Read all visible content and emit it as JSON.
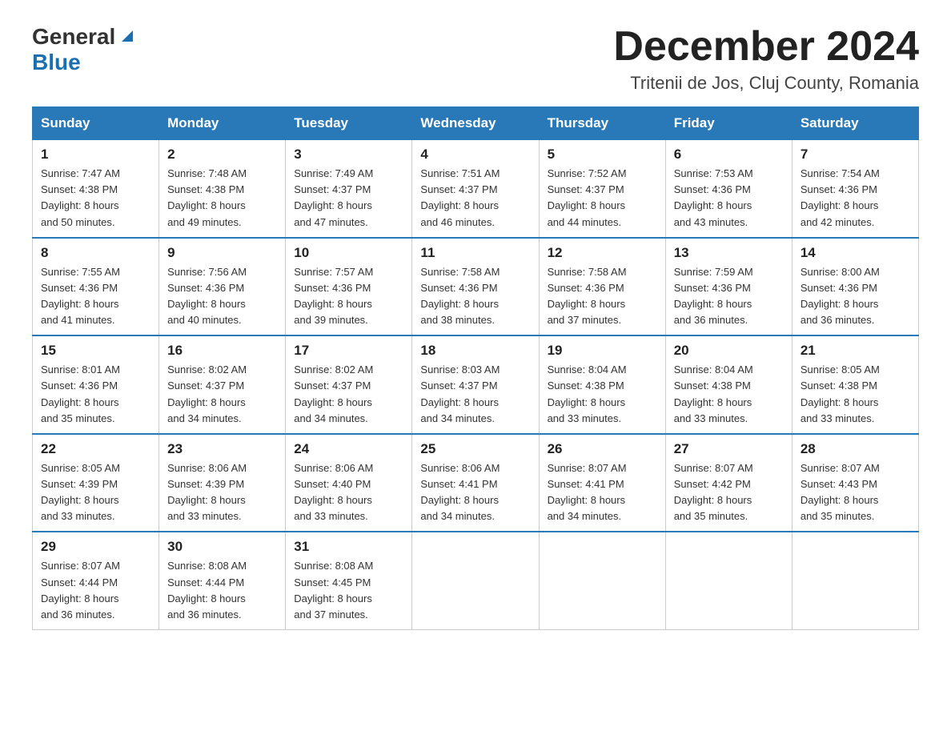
{
  "logo": {
    "general": "General",
    "blue": "Blue"
  },
  "title": {
    "month": "December 2024",
    "location": "Tritenii de Jos, Cluj County, Romania"
  },
  "weekdays": [
    "Sunday",
    "Monday",
    "Tuesday",
    "Wednesday",
    "Thursday",
    "Friday",
    "Saturday"
  ],
  "weeks": [
    [
      {
        "day": "1",
        "sunrise": "7:47 AM",
        "sunset": "4:38 PM",
        "daylight": "8 hours and 50 minutes."
      },
      {
        "day": "2",
        "sunrise": "7:48 AM",
        "sunset": "4:38 PM",
        "daylight": "8 hours and 49 minutes."
      },
      {
        "day": "3",
        "sunrise": "7:49 AM",
        "sunset": "4:37 PM",
        "daylight": "8 hours and 47 minutes."
      },
      {
        "day": "4",
        "sunrise": "7:51 AM",
        "sunset": "4:37 PM",
        "daylight": "8 hours and 46 minutes."
      },
      {
        "day": "5",
        "sunrise": "7:52 AM",
        "sunset": "4:37 PM",
        "daylight": "8 hours and 44 minutes."
      },
      {
        "day": "6",
        "sunrise": "7:53 AM",
        "sunset": "4:36 PM",
        "daylight": "8 hours and 43 minutes."
      },
      {
        "day": "7",
        "sunrise": "7:54 AM",
        "sunset": "4:36 PM",
        "daylight": "8 hours and 42 minutes."
      }
    ],
    [
      {
        "day": "8",
        "sunrise": "7:55 AM",
        "sunset": "4:36 PM",
        "daylight": "8 hours and 41 minutes."
      },
      {
        "day": "9",
        "sunrise": "7:56 AM",
        "sunset": "4:36 PM",
        "daylight": "8 hours and 40 minutes."
      },
      {
        "day": "10",
        "sunrise": "7:57 AM",
        "sunset": "4:36 PM",
        "daylight": "8 hours and 39 minutes."
      },
      {
        "day": "11",
        "sunrise": "7:58 AM",
        "sunset": "4:36 PM",
        "daylight": "8 hours and 38 minutes."
      },
      {
        "day": "12",
        "sunrise": "7:58 AM",
        "sunset": "4:36 PM",
        "daylight": "8 hours and 37 minutes."
      },
      {
        "day": "13",
        "sunrise": "7:59 AM",
        "sunset": "4:36 PM",
        "daylight": "8 hours and 36 minutes."
      },
      {
        "day": "14",
        "sunrise": "8:00 AM",
        "sunset": "4:36 PM",
        "daylight": "8 hours and 36 minutes."
      }
    ],
    [
      {
        "day": "15",
        "sunrise": "8:01 AM",
        "sunset": "4:36 PM",
        "daylight": "8 hours and 35 minutes."
      },
      {
        "day": "16",
        "sunrise": "8:02 AM",
        "sunset": "4:37 PM",
        "daylight": "8 hours and 34 minutes."
      },
      {
        "day": "17",
        "sunrise": "8:02 AM",
        "sunset": "4:37 PM",
        "daylight": "8 hours and 34 minutes."
      },
      {
        "day": "18",
        "sunrise": "8:03 AM",
        "sunset": "4:37 PM",
        "daylight": "8 hours and 34 minutes."
      },
      {
        "day": "19",
        "sunrise": "8:04 AM",
        "sunset": "4:38 PM",
        "daylight": "8 hours and 33 minutes."
      },
      {
        "day": "20",
        "sunrise": "8:04 AM",
        "sunset": "4:38 PM",
        "daylight": "8 hours and 33 minutes."
      },
      {
        "day": "21",
        "sunrise": "8:05 AM",
        "sunset": "4:38 PM",
        "daylight": "8 hours and 33 minutes."
      }
    ],
    [
      {
        "day": "22",
        "sunrise": "8:05 AM",
        "sunset": "4:39 PM",
        "daylight": "8 hours and 33 minutes."
      },
      {
        "day": "23",
        "sunrise": "8:06 AM",
        "sunset": "4:39 PM",
        "daylight": "8 hours and 33 minutes."
      },
      {
        "day": "24",
        "sunrise": "8:06 AM",
        "sunset": "4:40 PM",
        "daylight": "8 hours and 33 minutes."
      },
      {
        "day": "25",
        "sunrise": "8:06 AM",
        "sunset": "4:41 PM",
        "daylight": "8 hours and 34 minutes."
      },
      {
        "day": "26",
        "sunrise": "8:07 AM",
        "sunset": "4:41 PM",
        "daylight": "8 hours and 34 minutes."
      },
      {
        "day": "27",
        "sunrise": "8:07 AM",
        "sunset": "4:42 PM",
        "daylight": "8 hours and 35 minutes."
      },
      {
        "day": "28",
        "sunrise": "8:07 AM",
        "sunset": "4:43 PM",
        "daylight": "8 hours and 35 minutes."
      }
    ],
    [
      {
        "day": "29",
        "sunrise": "8:07 AM",
        "sunset": "4:44 PM",
        "daylight": "8 hours and 36 minutes."
      },
      {
        "day": "30",
        "sunrise": "8:08 AM",
        "sunset": "4:44 PM",
        "daylight": "8 hours and 36 minutes."
      },
      {
        "day": "31",
        "sunrise": "8:08 AM",
        "sunset": "4:45 PM",
        "daylight": "8 hours and 37 minutes."
      },
      null,
      null,
      null,
      null
    ]
  ],
  "labels": {
    "sunrise": "Sunrise:",
    "sunset": "Sunset:",
    "daylight": "Daylight:"
  }
}
